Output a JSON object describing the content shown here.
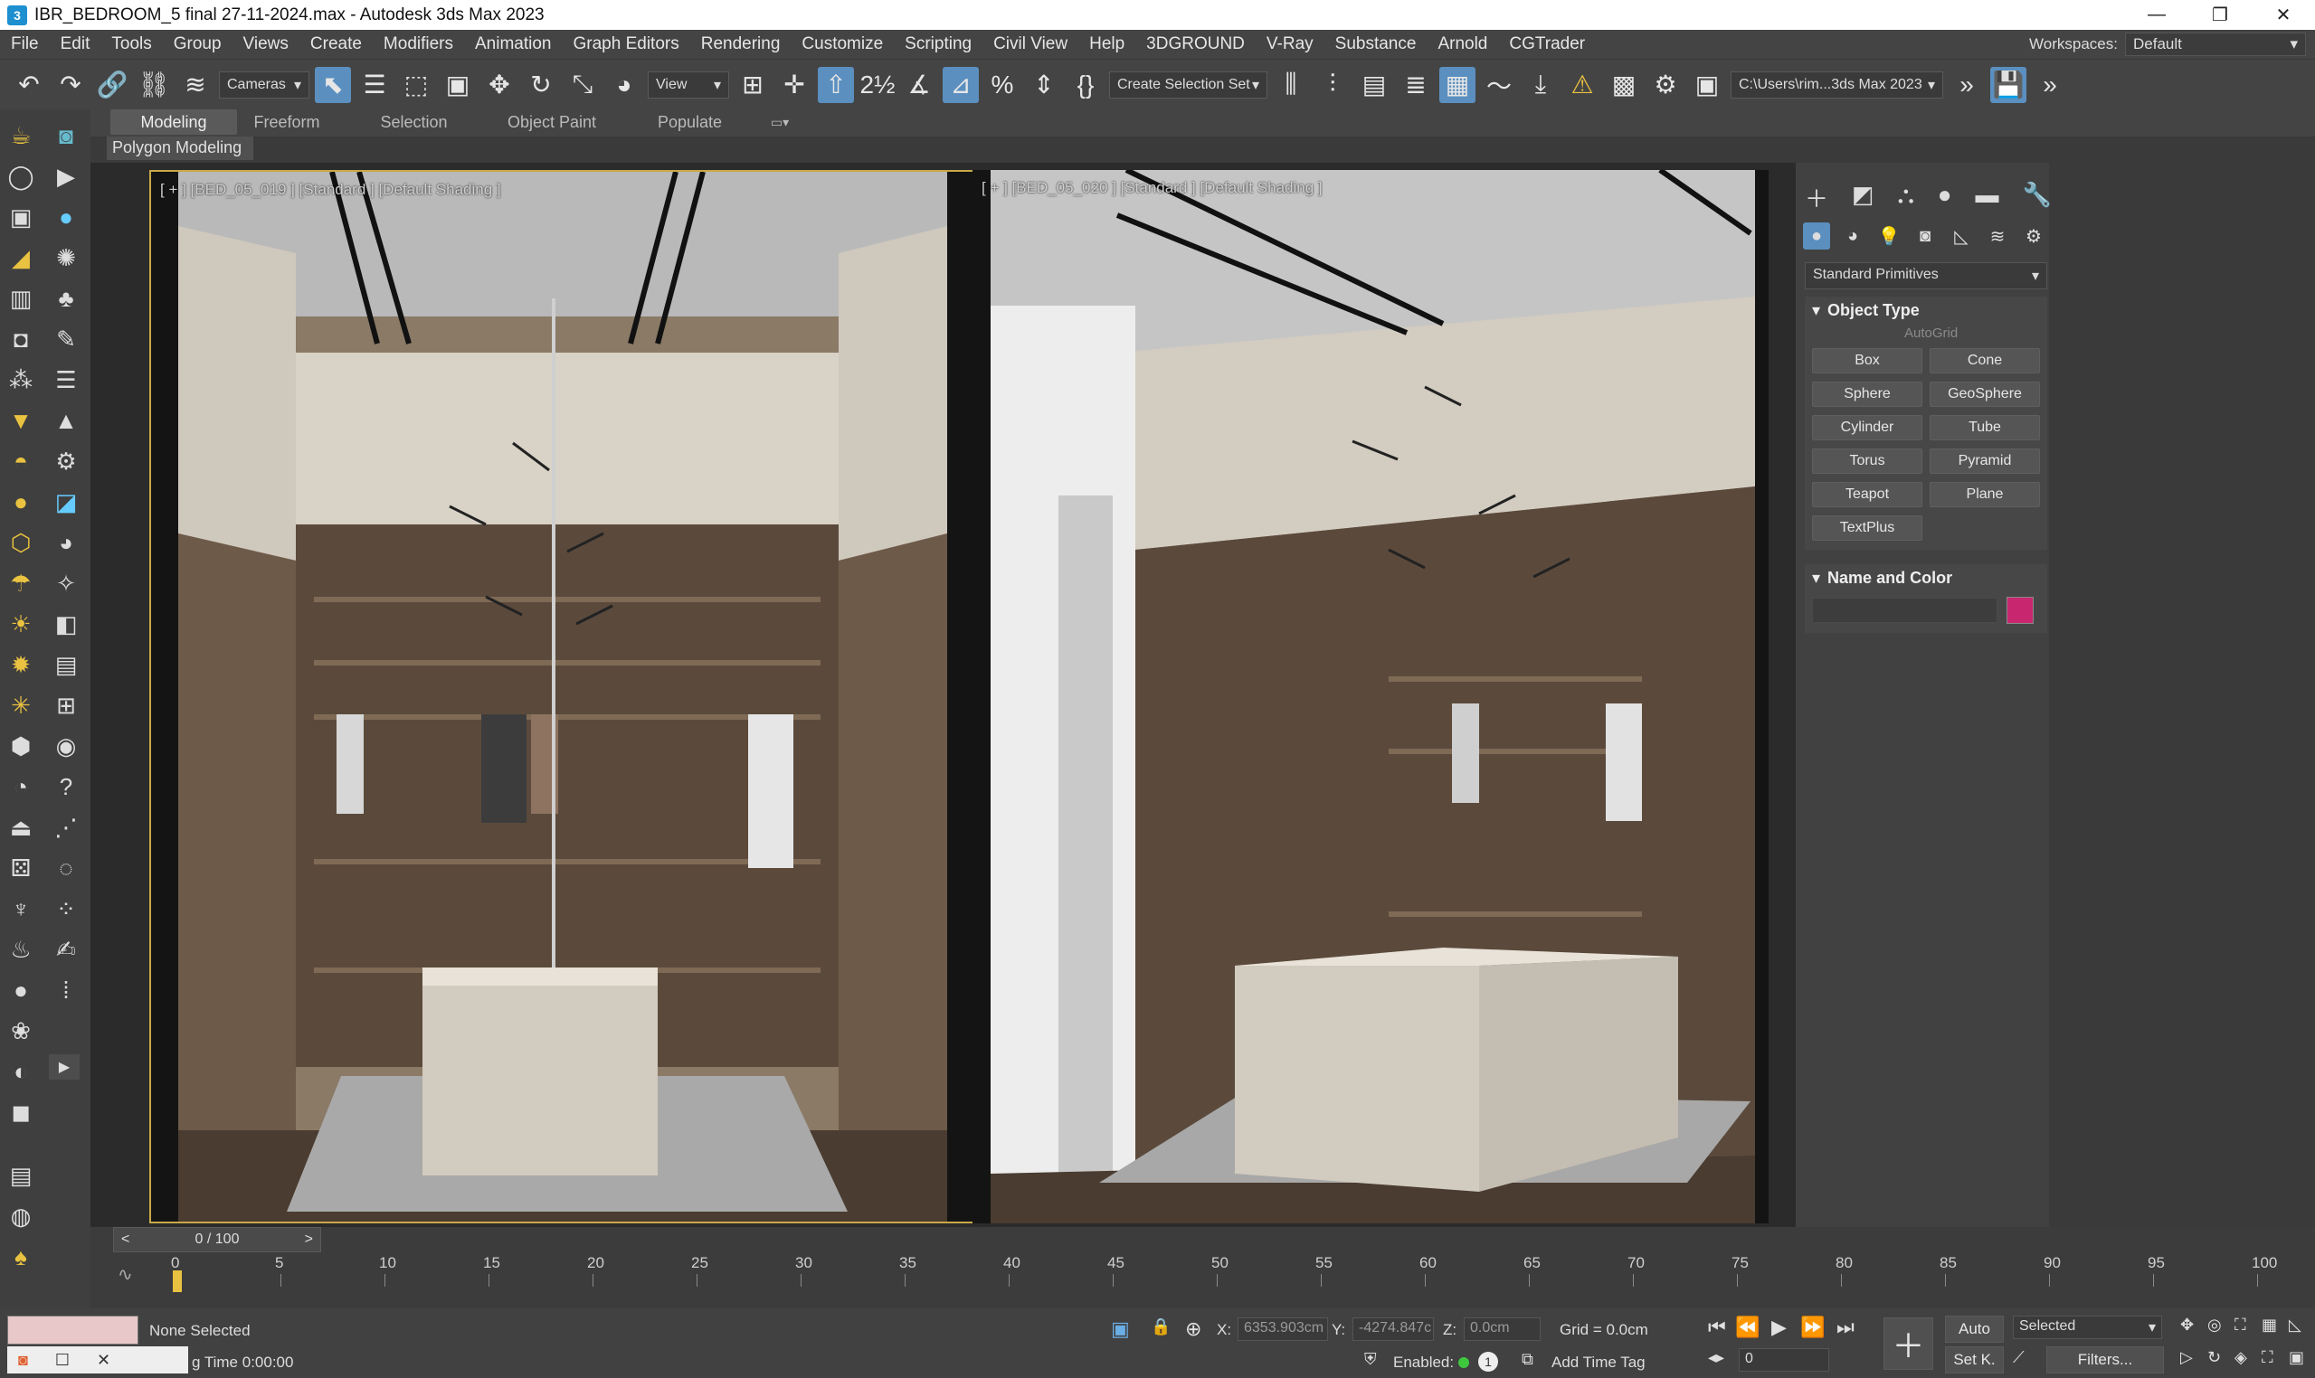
{
  "window": {
    "title": "IBR_BEDROOM_5 final 27-11-2024.max - Autodesk 3ds Max 2023",
    "app_icon": "3",
    "controls": [
      "—",
      "❐",
      "✕"
    ]
  },
  "menu": {
    "items": [
      "File",
      "Edit",
      "Tools",
      "Group",
      "Views",
      "Create",
      "Modifiers",
      "Animation",
      "Graph Editors",
      "Rendering",
      "Customize",
      "Scripting",
      "Civil View",
      "Help",
      "3DGROUND",
      "V-Ray",
      "Substance",
      "Arnold",
      "CGTrader"
    ],
    "workspaces_label": "Workspaces:",
    "workspaces_value": "Default"
  },
  "toolbar": {
    "cameras_label": "Cameras",
    "view_label": "View",
    "selection_set_label": "Create Selection Set",
    "path_label": "C:\\Users\\rim...3ds Max 2023"
  },
  "ribbon": {
    "tabs": [
      "Modeling",
      "Freeform",
      "Selection",
      "Object Paint",
      "Populate"
    ],
    "panel_label": "Polygon Modeling"
  },
  "viewports": [
    {
      "label": "[ + ] [BED_05_019 ] [Standard ] [Default Shading ]"
    },
    {
      "label": "[ + ] [BED_05_020 ] [Standard ] [Default Shading ]"
    }
  ],
  "command_panel": {
    "category": "Standard Primitives",
    "object_type_title": "Object Type",
    "autogrid_label": "AutoGrid",
    "primitives": [
      "Box",
      "Cone",
      "Sphere",
      "GeoSphere",
      "Cylinder",
      "Tube",
      "Torus",
      "Pyramid",
      "Teapot",
      "Plane",
      "TextPlus"
    ],
    "name_color_title": "Name and Color",
    "color": "#c8276f"
  },
  "timeline": {
    "frame_display": "0 / 100",
    "prev": "<",
    "next": ">",
    "ticks": [
      "0",
      "5",
      "10",
      "15",
      "20",
      "25",
      "30",
      "35",
      "40",
      "45",
      "50",
      "55",
      "60",
      "65",
      "70",
      "75",
      "80",
      "85",
      "90",
      "95",
      "100"
    ]
  },
  "status": {
    "selection": "None Selected",
    "time_label": "g Time  0:00:00",
    "x_label": "X:",
    "x_value": "6353.903cm",
    "y_label": "Y:",
    "y_value": "-4274.847c",
    "z_label": "Z:",
    "z_value": "0.0cm",
    "grid": "Grid = 0.0cm",
    "enabled_label": "Enabled:",
    "add_time_tag": "Add Time Tag",
    "auto_label": "Auto",
    "selected_value": "Selected",
    "set_key": "Set K.",
    "filters": "Filters...",
    "frame_value": "0"
  },
  "colors": {
    "accent": "#5b8fbf",
    "active_viewport_border": "#c9a848",
    "ui_bg": "#444444"
  }
}
